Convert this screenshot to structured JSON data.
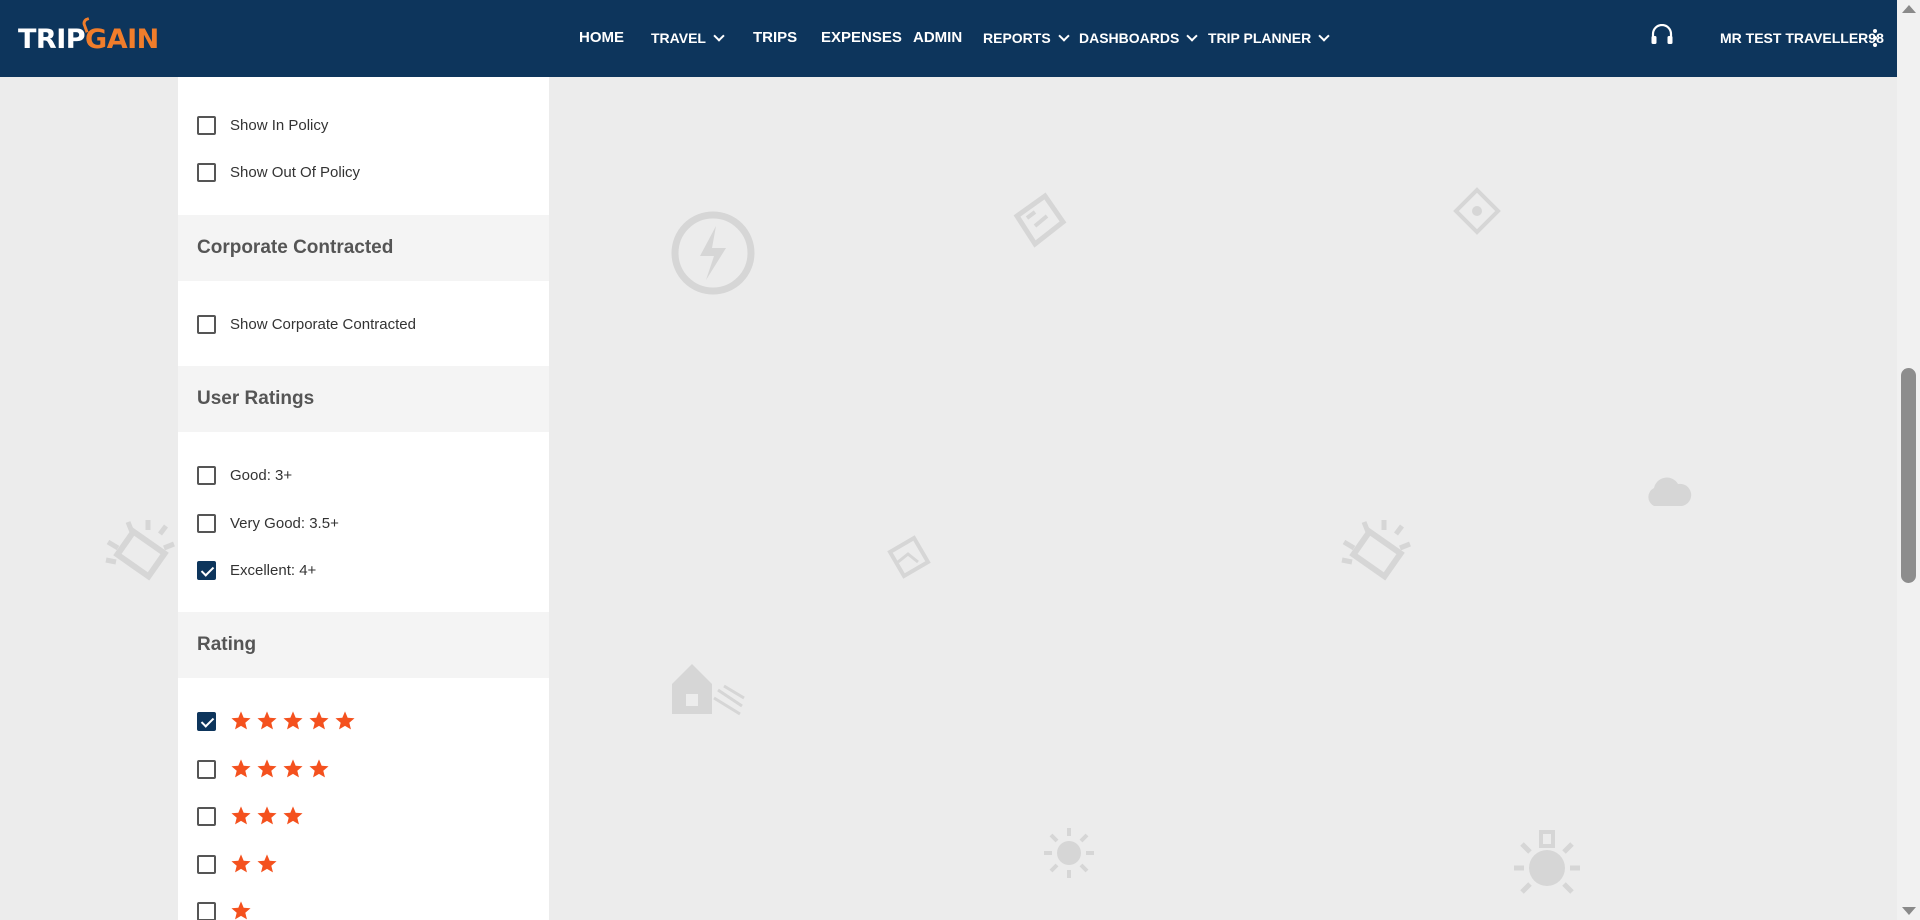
{
  "brand": {
    "logo_part1": "TRIP",
    "logo_part2": "GAIN",
    "primary_color": "#0d355c",
    "accent_color": "#f07d2b"
  },
  "nav": {
    "items": [
      {
        "label": "HOME",
        "dropdown": false
      },
      {
        "label": "TRAVEL",
        "dropdown": true
      },
      {
        "label": "TRIPS",
        "dropdown": false
      },
      {
        "label": "EXPENSES",
        "dropdown": false
      },
      {
        "label": "ADMIN",
        "dropdown": false
      },
      {
        "label": "REPORTS",
        "dropdown": true
      },
      {
        "label": "DASHBOARDS",
        "dropdown": true
      },
      {
        "label": "TRIP PLANNER",
        "dropdown": true
      }
    ],
    "support_icon": "headset-icon",
    "user_name": "MR TEST TRAVELLER98",
    "menu_icon": "kebab-menu-icon"
  },
  "filters": {
    "policy": {
      "options": [
        {
          "label": "Show In Policy",
          "checked": false
        },
        {
          "label": "Show Out Of Policy",
          "checked": false
        }
      ]
    },
    "corporate": {
      "title": "Corporate Contracted",
      "options": [
        {
          "label": "Show Corporate Contracted",
          "checked": false
        }
      ]
    },
    "user_ratings": {
      "title": "User Ratings",
      "options": [
        {
          "label": "Good: 3+",
          "checked": false
        },
        {
          "label": "Very Good: 3.5+",
          "checked": false
        },
        {
          "label": "Excellent: 4+",
          "checked": true
        }
      ]
    },
    "rating": {
      "title": "Rating",
      "star_color": "#f4511e",
      "options": [
        {
          "stars": 5,
          "checked": true
        },
        {
          "stars": 4,
          "checked": false
        },
        {
          "stars": 3,
          "checked": false
        },
        {
          "stars": 2,
          "checked": false
        },
        {
          "stars": 1,
          "checked": false
        }
      ]
    }
  }
}
